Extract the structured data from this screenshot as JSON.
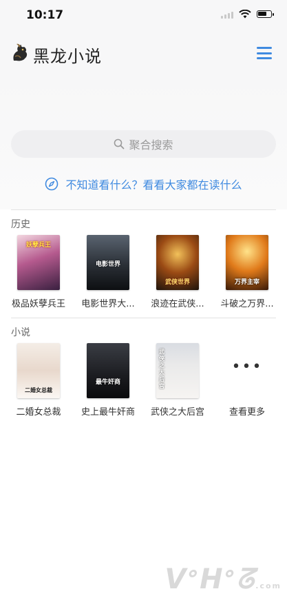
{
  "status": {
    "time": "10:17"
  },
  "header": {
    "title": "黑龙小说",
    "menu_icon": "menu-icon"
  },
  "search": {
    "placeholder": "聚合搜索"
  },
  "discover": {
    "text": "不知道看什么？看看大家都在读什么"
  },
  "history": {
    "title": "历史",
    "books": [
      {
        "title": "极品妖孽兵王",
        "cover_text": "妖孽兵王"
      },
      {
        "title": "电影世界大...",
        "cover_text": "电影世界"
      },
      {
        "title": "浪迹在武侠...",
        "cover_text": "武侠世界"
      },
      {
        "title": "斗破之万界...",
        "cover_text": "万界主宰"
      }
    ]
  },
  "novels": {
    "title": "小说",
    "books": [
      {
        "title": "二婚女总裁",
        "cover_text": "二婚女总裁"
      },
      {
        "title": "史上最牛奸商",
        "cover_text": "最牛奸商"
      },
      {
        "title": "武侠之大后宫",
        "cover_text": "武侠之大后宫"
      }
    ],
    "more": {
      "title": "查看更多",
      "icon": "more-dots-icon"
    }
  },
  "watermark": {
    "text": "ᐯᐤᕼᐤᘔ",
    "suffix": ".com"
  },
  "colors": {
    "accent": "#3f8ae0",
    "background": "#ffffff",
    "header_bg": "#f7f7f8"
  }
}
